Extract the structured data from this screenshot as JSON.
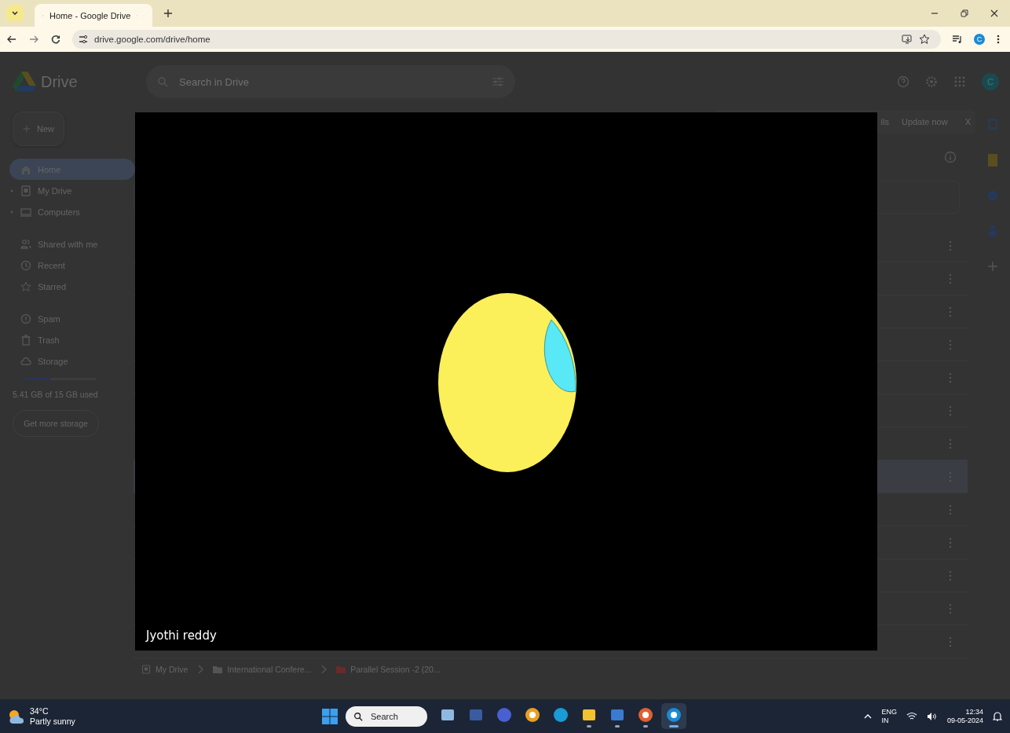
{
  "browser": {
    "tab": {
      "title": "Home - Google Drive"
    },
    "url": "drive.google.com/drive/home",
    "profile": "C"
  },
  "drive": {
    "app_name": "Drive",
    "search": {
      "placeholder": "Search in Drive"
    },
    "avatar": "C",
    "new_button": "New",
    "sidebar": [
      {
        "label": "Home",
        "selected": true
      },
      {
        "label": "My Drive",
        "selected": false
      },
      {
        "label": "Computers",
        "selected": false
      },
      {
        "label": "Shared with me",
        "selected": false
      },
      {
        "label": "Recent",
        "selected": false
      },
      {
        "label": "Starred",
        "selected": false
      },
      {
        "label": "Spam",
        "selected": false
      },
      {
        "label": "Trash",
        "selected": false
      },
      {
        "label": "Storage",
        "selected": false
      }
    ],
    "storage": {
      "level": 0.36,
      "used": "5.41 GB of 15 GB used",
      "button": "Get more storage"
    },
    "banner": {
      "text": "ils",
      "action": "Update now",
      "close": "X"
    },
    "file_rows": [
      {
        "selected": false
      },
      {
        "selected": false
      },
      {
        "selected": false
      },
      {
        "selected": false
      },
      {
        "selected": false
      },
      {
        "selected": false
      },
      {
        "selected": false
      },
      {
        "selected": true
      },
      {
        "selected": false
      },
      {
        "selected": false
      },
      {
        "selected": false
      },
      {
        "selected": false
      },
      {
        "selected": false
      }
    ],
    "breadcrumb": [
      {
        "label": "My Drive",
        "kind": "drive"
      },
      {
        "label": "International Confere...",
        "kind": "folder",
        "color": "#555555"
      },
      {
        "label": "Parallel Session -2 (20...",
        "kind": "folder",
        "color": "#6a2a2a"
      }
    ]
  },
  "video": {
    "caption": "Jyothi reddy"
  },
  "taskbar": {
    "weather": {
      "temp": "34°C",
      "condition": "Partly sunny"
    },
    "search": {
      "placeholder": "Search"
    },
    "apps": [
      {
        "running": false,
        "selected": false
      },
      {
        "running": false,
        "selected": false
      },
      {
        "running": false,
        "selected": false
      },
      {
        "running": false,
        "selected": false
      },
      {
        "running": false,
        "selected": false
      },
      {
        "running": true,
        "selected": false
      },
      {
        "running": true,
        "selected": false
      },
      {
        "running": true,
        "selected": false
      },
      {
        "running": true,
        "selected": true
      }
    ],
    "tray": {
      "lang": "ENG",
      "region": "IN",
      "time": "12:34",
      "date": "09-05-2024"
    }
  }
}
